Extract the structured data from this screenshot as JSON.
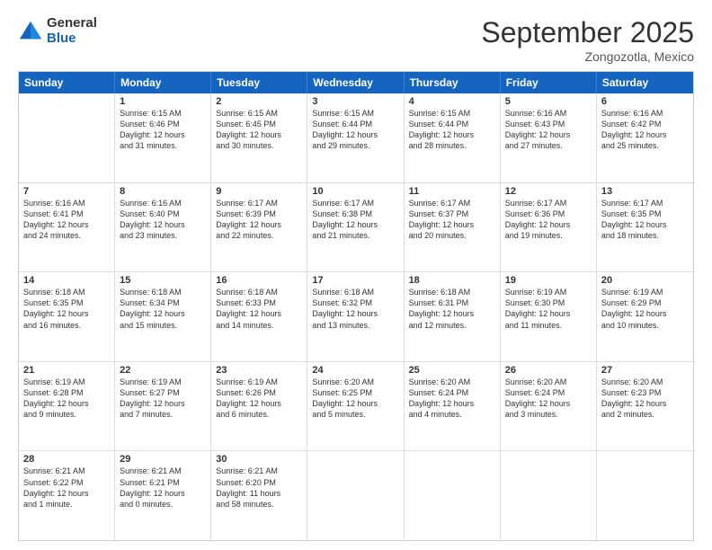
{
  "logo": {
    "general": "General",
    "blue": "Blue"
  },
  "header": {
    "month": "September 2025",
    "location": "Zongozotla, Mexico"
  },
  "dayHeaders": [
    "Sunday",
    "Monday",
    "Tuesday",
    "Wednesday",
    "Thursday",
    "Friday",
    "Saturday"
  ],
  "weeks": [
    [
      {
        "num": "",
        "info": ""
      },
      {
        "num": "1",
        "info": "Sunrise: 6:15 AM\nSunset: 6:46 PM\nDaylight: 12 hours\nand 31 minutes."
      },
      {
        "num": "2",
        "info": "Sunrise: 6:15 AM\nSunset: 6:45 PM\nDaylight: 12 hours\nand 30 minutes."
      },
      {
        "num": "3",
        "info": "Sunrise: 6:15 AM\nSunset: 6:44 PM\nDaylight: 12 hours\nand 29 minutes."
      },
      {
        "num": "4",
        "info": "Sunrise: 6:15 AM\nSunset: 6:44 PM\nDaylight: 12 hours\nand 28 minutes."
      },
      {
        "num": "5",
        "info": "Sunrise: 6:16 AM\nSunset: 6:43 PM\nDaylight: 12 hours\nand 27 minutes."
      },
      {
        "num": "6",
        "info": "Sunrise: 6:16 AM\nSunset: 6:42 PM\nDaylight: 12 hours\nand 25 minutes."
      }
    ],
    [
      {
        "num": "7",
        "info": "Sunrise: 6:16 AM\nSunset: 6:41 PM\nDaylight: 12 hours\nand 24 minutes."
      },
      {
        "num": "8",
        "info": "Sunrise: 6:16 AM\nSunset: 6:40 PM\nDaylight: 12 hours\nand 23 minutes."
      },
      {
        "num": "9",
        "info": "Sunrise: 6:17 AM\nSunset: 6:39 PM\nDaylight: 12 hours\nand 22 minutes."
      },
      {
        "num": "10",
        "info": "Sunrise: 6:17 AM\nSunset: 6:38 PM\nDaylight: 12 hours\nand 21 minutes."
      },
      {
        "num": "11",
        "info": "Sunrise: 6:17 AM\nSunset: 6:37 PM\nDaylight: 12 hours\nand 20 minutes."
      },
      {
        "num": "12",
        "info": "Sunrise: 6:17 AM\nSunset: 6:36 PM\nDaylight: 12 hours\nand 19 minutes."
      },
      {
        "num": "13",
        "info": "Sunrise: 6:17 AM\nSunset: 6:35 PM\nDaylight: 12 hours\nand 18 minutes."
      }
    ],
    [
      {
        "num": "14",
        "info": "Sunrise: 6:18 AM\nSunset: 6:35 PM\nDaylight: 12 hours\nand 16 minutes."
      },
      {
        "num": "15",
        "info": "Sunrise: 6:18 AM\nSunset: 6:34 PM\nDaylight: 12 hours\nand 15 minutes."
      },
      {
        "num": "16",
        "info": "Sunrise: 6:18 AM\nSunset: 6:33 PM\nDaylight: 12 hours\nand 14 minutes."
      },
      {
        "num": "17",
        "info": "Sunrise: 6:18 AM\nSunset: 6:32 PM\nDaylight: 12 hours\nand 13 minutes."
      },
      {
        "num": "18",
        "info": "Sunrise: 6:18 AM\nSunset: 6:31 PM\nDaylight: 12 hours\nand 12 minutes."
      },
      {
        "num": "19",
        "info": "Sunrise: 6:19 AM\nSunset: 6:30 PM\nDaylight: 12 hours\nand 11 minutes."
      },
      {
        "num": "20",
        "info": "Sunrise: 6:19 AM\nSunset: 6:29 PM\nDaylight: 12 hours\nand 10 minutes."
      }
    ],
    [
      {
        "num": "21",
        "info": "Sunrise: 6:19 AM\nSunset: 6:28 PM\nDaylight: 12 hours\nand 9 minutes."
      },
      {
        "num": "22",
        "info": "Sunrise: 6:19 AM\nSunset: 6:27 PM\nDaylight: 12 hours\nand 7 minutes."
      },
      {
        "num": "23",
        "info": "Sunrise: 6:19 AM\nSunset: 6:26 PM\nDaylight: 12 hours\nand 6 minutes."
      },
      {
        "num": "24",
        "info": "Sunrise: 6:20 AM\nSunset: 6:25 PM\nDaylight: 12 hours\nand 5 minutes."
      },
      {
        "num": "25",
        "info": "Sunrise: 6:20 AM\nSunset: 6:24 PM\nDaylight: 12 hours\nand 4 minutes."
      },
      {
        "num": "26",
        "info": "Sunrise: 6:20 AM\nSunset: 6:24 PM\nDaylight: 12 hours\nand 3 minutes."
      },
      {
        "num": "27",
        "info": "Sunrise: 6:20 AM\nSunset: 6:23 PM\nDaylight: 12 hours\nand 2 minutes."
      }
    ],
    [
      {
        "num": "28",
        "info": "Sunrise: 6:21 AM\nSunset: 6:22 PM\nDaylight: 12 hours\nand 1 minute."
      },
      {
        "num": "29",
        "info": "Sunrise: 6:21 AM\nSunset: 6:21 PM\nDaylight: 12 hours\nand 0 minutes."
      },
      {
        "num": "30",
        "info": "Sunrise: 6:21 AM\nSunset: 6:20 PM\nDaylight: 11 hours\nand 58 minutes."
      },
      {
        "num": "",
        "info": ""
      },
      {
        "num": "",
        "info": ""
      },
      {
        "num": "",
        "info": ""
      },
      {
        "num": "",
        "info": ""
      }
    ]
  ]
}
